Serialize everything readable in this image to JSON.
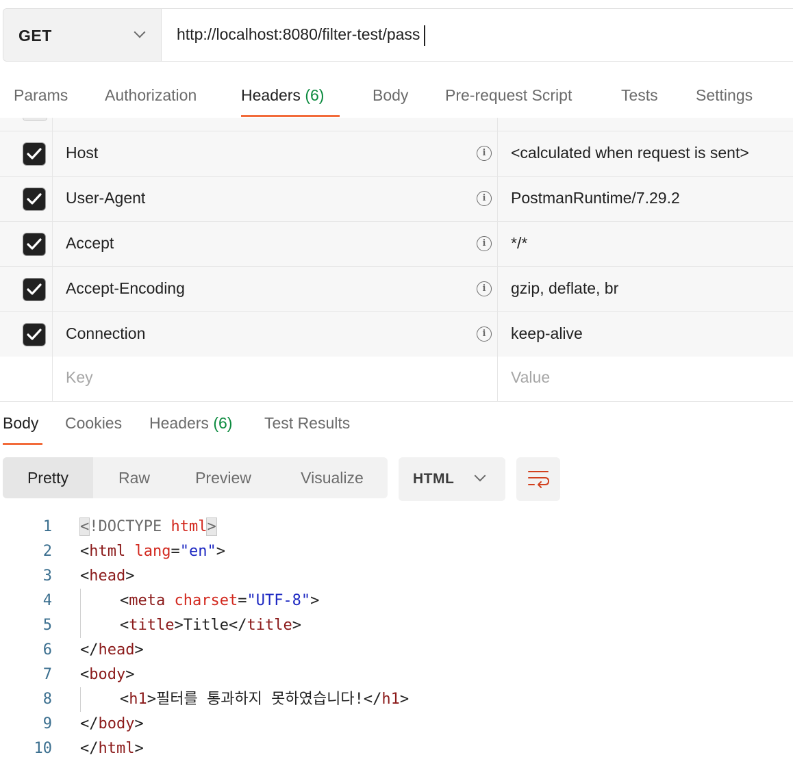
{
  "request": {
    "method": "GET",
    "url": "http://localhost:8080/filter-test/pass"
  },
  "request_tabs": [
    {
      "label": "Params"
    },
    {
      "label": "Authorization"
    },
    {
      "label": "Headers",
      "count": "(6)"
    },
    {
      "label": "Body"
    },
    {
      "label": "Pre-request Script"
    },
    {
      "label": "Tests"
    },
    {
      "label": "Settings"
    }
  ],
  "headers": [
    {
      "key": "Host",
      "value": "<calculated when request is sent>",
      "checked": true
    },
    {
      "key": "User-Agent",
      "value": "PostmanRuntime/7.29.2",
      "checked": true
    },
    {
      "key": "Accept",
      "value": "*/*",
      "checked": true
    },
    {
      "key": "Accept-Encoding",
      "value": "gzip, deflate, br",
      "checked": true
    },
    {
      "key": "Connection",
      "value": "keep-alive",
      "checked": true
    }
  ],
  "new_header": {
    "key_placeholder": "Key",
    "value_placeholder": "Value"
  },
  "response_tabs": [
    {
      "label": "Body"
    },
    {
      "label": "Cookies"
    },
    {
      "label": "Headers",
      "count": "(6)"
    },
    {
      "label": "Test Results"
    }
  ],
  "view_modes": [
    "Pretty",
    "Raw",
    "Preview",
    "Visualize"
  ],
  "language": "HTML",
  "code": {
    "line_numbers": [
      "1",
      "2",
      "3",
      "4",
      "5",
      "6",
      "7",
      "8",
      "9",
      "10"
    ],
    "l1": {
      "lt": "<",
      "decl": "!DOCTYPE",
      "kw": "html",
      "gt": ">"
    },
    "l2": {
      "open": "<",
      "tag": "html",
      "attr": "lang",
      "eq": "=",
      "val": "\"en\"",
      "close": ">"
    },
    "l3": {
      "open": "<",
      "tag": "head",
      "close": ">"
    },
    "l4": {
      "open": "<",
      "tag": "meta",
      "attr": "charset",
      "eq": "=",
      "val": "\"UTF-8\"",
      "close": ">"
    },
    "l5": {
      "open": "<",
      "tag": "title",
      "close": ">",
      "text": "Title",
      "eopen": "</",
      "etag": "title",
      "eclose": ">"
    },
    "l6": {
      "open": "</",
      "tag": "head",
      "close": ">"
    },
    "l7": {
      "open": "<",
      "tag": "body",
      "close": ">"
    },
    "l8": {
      "open": "<",
      "tag": "h1",
      "close": ">",
      "text": "필터를 통과하지 못하였습니다!",
      "eopen": "</",
      "etag": "h1",
      "eclose": ">"
    },
    "l9": {
      "open": "</",
      "tag": "body",
      "close": ">"
    },
    "l10": {
      "open": "</",
      "tag": "html",
      "close": ">"
    }
  }
}
